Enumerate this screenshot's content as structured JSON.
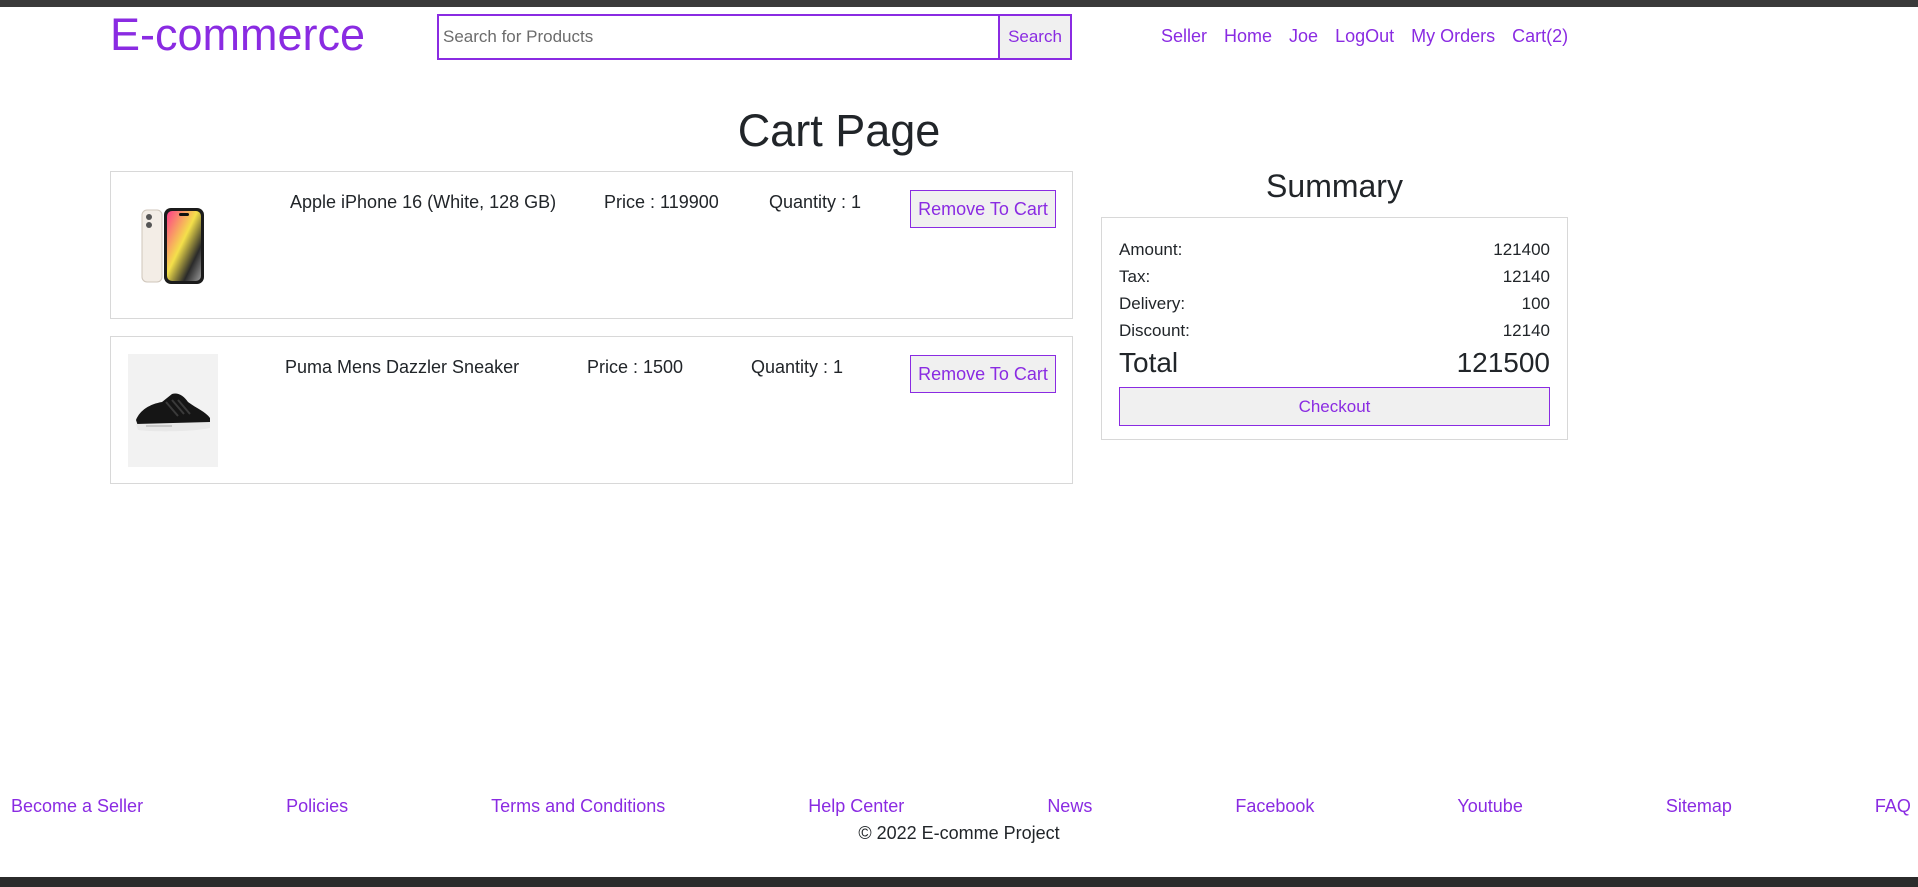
{
  "header": {
    "logo": "E-commerce",
    "search_placeholder": "Search for Products",
    "search_button": "Search",
    "nav": [
      "Seller",
      "Home",
      "Joe",
      "LogOut",
      "My Orders",
      "Cart(2)"
    ]
  },
  "page_title": "Cart Page",
  "cart_items": [
    {
      "name": "Apple iPhone 16 (White, 128 GB)",
      "price": "Price : 119900",
      "quantity": "Quantity : 1",
      "remove_label": "Remove To Cart",
      "image_icon": "smartphone-image"
    },
    {
      "name": "Puma Mens Dazzler Sneaker",
      "price": "Price : 1500",
      "quantity": "Quantity : 1",
      "remove_label": "Remove To Cart",
      "image_icon": "sneaker-image"
    }
  ],
  "summary": {
    "title": "Summary",
    "rows": [
      {
        "label": "Amount:",
        "value": "121400"
      },
      {
        "label": "Tax:",
        "value": "12140"
      },
      {
        "label": "Delivery:",
        "value": "100"
      },
      {
        "label": "Discount:",
        "value": "12140"
      }
    ],
    "total_label": "Total",
    "total_value": "121500",
    "checkout_label": "Checkout"
  },
  "footer": {
    "links": [
      "Become a Seller",
      "Policies",
      "Terms and Conditions",
      "Help Center",
      "News",
      "Facebook",
      "Youtube",
      "Sitemap",
      "FAQ"
    ],
    "copyright": "© 2022 E-comme Project"
  },
  "colors": {
    "accent": "#8a2be2",
    "text": "#212529",
    "border": "#d8d8d8",
    "button_bg": "#f0f0f0"
  }
}
